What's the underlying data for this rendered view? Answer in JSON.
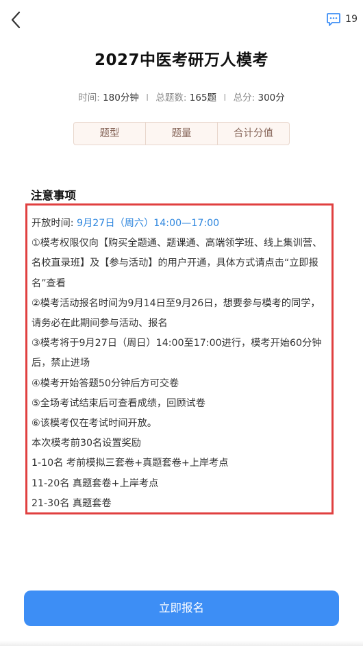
{
  "header": {
    "back_icon": "chevron-left-icon",
    "message_icon": "message-dots-icon",
    "message_count": "19",
    "accent_color": "#3d8ef5"
  },
  "exam": {
    "title": "2027中医考研万人模考",
    "time_label": "时间:",
    "time_value": "180分钟",
    "separator": "I",
    "questions_label": "总题数:",
    "questions_value": "165题",
    "score_label": "总分:",
    "score_value": "300分"
  },
  "tabs": [
    {
      "label": "题型"
    },
    {
      "label": "题量"
    },
    {
      "label": "合计分值"
    }
  ],
  "notice": {
    "title": "注意事项",
    "open_time_label": "开放时间:",
    "open_time_value": "9月27日（周六）14:00—17:00",
    "lines": [
      "①模考权限仅向【购买全题通、题课通、高端领学班、线上集训营、名校直录班】及【参与活动】的用户开通，具体方式请点击“立即报名”查看",
      "②模考活动报名时间为9月14日至9月26日，想要参与模考的同学，请务必在此期间参与活动、报名",
      "③模考将于9月27日（周日）14:00至17:00进行，模考开始60分钟后，禁止进场",
      "④模考开始答题50分钟后方可交卷",
      "⑤全场考试结束后可查看成绩，回顾试卷",
      "⑥该模考仅在考试时间开放。",
      "本次模考前30名设置奖励",
      "1-10名  考前模拟三套卷+真题套卷+上岸考点",
      "11-20名 真题套卷+上岸考点",
      "21-30名 真题套卷"
    ],
    "highlight_border_color": "#e04040"
  },
  "signup": {
    "label": "立即报名",
    "color": "#3d8ef5"
  }
}
